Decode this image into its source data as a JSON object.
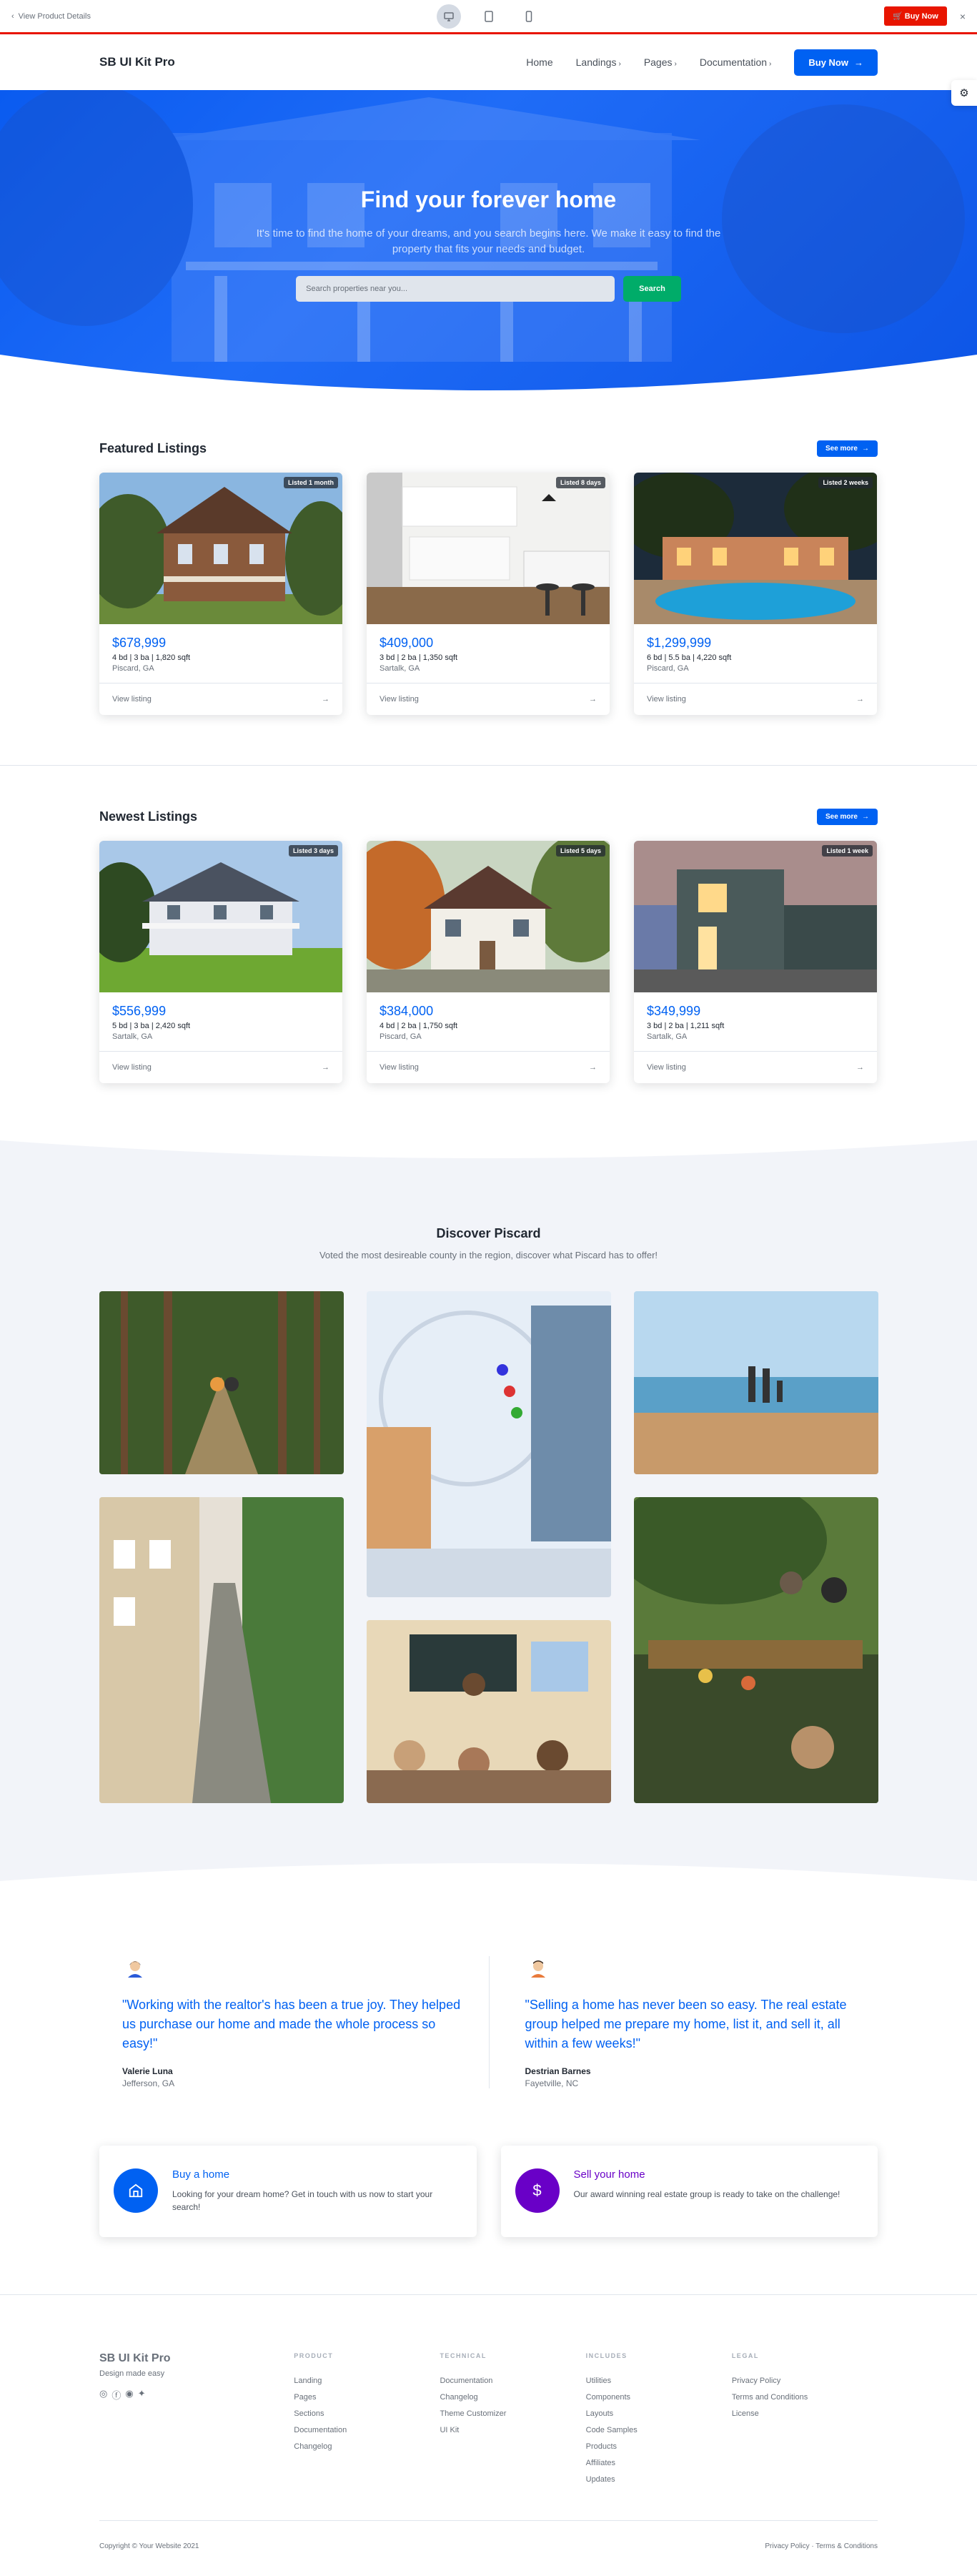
{
  "preview": {
    "back_label": "View Product Details",
    "buy_label": "Buy Now",
    "close_glyph": "×"
  },
  "navbar": {
    "brand": "SB UI Kit Pro",
    "links": [
      {
        "label": "Home",
        "dropdown": false
      },
      {
        "label": "Landings",
        "dropdown": true
      },
      {
        "label": "Pages",
        "dropdown": true
      },
      {
        "label": "Documentation",
        "dropdown": true
      }
    ],
    "buy_label": "Buy Now"
  },
  "hero": {
    "title": "Find your forever home",
    "subtitle": "It's time to find the home of your dreams, and you search begins here. We make it easy to find the property that fits your needs and budget.",
    "search_placeholder": "Search properties near you...",
    "search_button": "Search"
  },
  "featured": {
    "title": "Featured Listings",
    "see_more": "See more",
    "cards": [
      {
        "badge": "Listed 1 month",
        "price": "$678,999",
        "specs": "4 bd | 3 ba | 1,820 sqft",
        "location": "Piscard, GA",
        "link": "View listing"
      },
      {
        "badge": "Listed 8 days",
        "price": "$409,000",
        "specs": "3 bd | 2 ba | 1,350 sqft",
        "location": "Sartalk, GA",
        "link": "View listing"
      },
      {
        "badge": "Listed 2 weeks",
        "price": "$1,299,999",
        "specs": "6 bd | 5.5 ba | 4,220 sqft",
        "location": "Piscard, GA",
        "link": "View listing"
      }
    ]
  },
  "newest": {
    "title": "Newest Listings",
    "see_more": "See more",
    "cards": [
      {
        "badge": "Listed 3 days",
        "price": "$556,999",
        "specs": "5 bd | 3 ba | 2,420 sqft",
        "location": "Sartalk, GA",
        "link": "View listing"
      },
      {
        "badge": "Listed 5 days",
        "price": "$384,000",
        "specs": "4 bd | 2 ba | 1,750 sqft",
        "location": "Piscard, GA",
        "link": "View listing"
      },
      {
        "badge": "Listed 1 week",
        "price": "$349,999",
        "specs": "3 bd | 2 ba | 1,211 sqft",
        "location": "Sartalk, GA",
        "link": "View listing"
      }
    ]
  },
  "discover": {
    "title": "Discover Piscard",
    "subtitle": "Voted the most desireable county in the region, discover what Piscard has to offer!"
  },
  "testimonials": [
    {
      "quote": "\"Working with the realtor's has been a true joy. They helped us purchase our home and made the whole process so easy!\"",
      "name": "Valerie Luna",
      "location": "Jefferson, GA"
    },
    {
      "quote": "\"Selling a home has never been so easy. The real estate group helped me prepare my home, list it, and sell it, all within a few weeks!\"",
      "name": "Destrian Barnes",
      "location": "Fayetville, NC"
    }
  ],
  "cta": [
    {
      "title": "Buy a home",
      "text": "Looking for your dream home? Get in touch with us now to start your search!",
      "color": "#0061f2",
      "icon": "home-icon"
    },
    {
      "title": "Sell your home",
      "text": "Our award winning real estate group is ready to take on the challenge!",
      "color": "#6900c7",
      "icon": "dollar-icon"
    }
  ],
  "footer": {
    "brand": "SB UI Kit Pro",
    "tagline": "Design made easy",
    "columns": [
      {
        "title": "PRODUCT",
        "items": [
          "Landing",
          "Pages",
          "Sections",
          "Documentation",
          "Changelog"
        ]
      },
      {
        "title": "TECHNICAL",
        "items": [
          "Documentation",
          "Changelog",
          "Theme Customizer",
          "UI Kit"
        ]
      },
      {
        "title": "INCLUDES",
        "items": [
          "Utilities",
          "Components",
          "Layouts",
          "Code Samples",
          "Products",
          "Affiliates",
          "Updates"
        ]
      },
      {
        "title": "LEGAL",
        "items": [
          "Privacy Policy",
          "Terms and Conditions",
          "License"
        ]
      }
    ],
    "copyright": "Copyright © Your Website 2021",
    "legal_links": "Privacy Policy · Terms & Conditions"
  },
  "colors": {
    "primary": "#0061f2",
    "success": "#00ac69",
    "danger": "#e81500",
    "purple": "#6900c7"
  }
}
